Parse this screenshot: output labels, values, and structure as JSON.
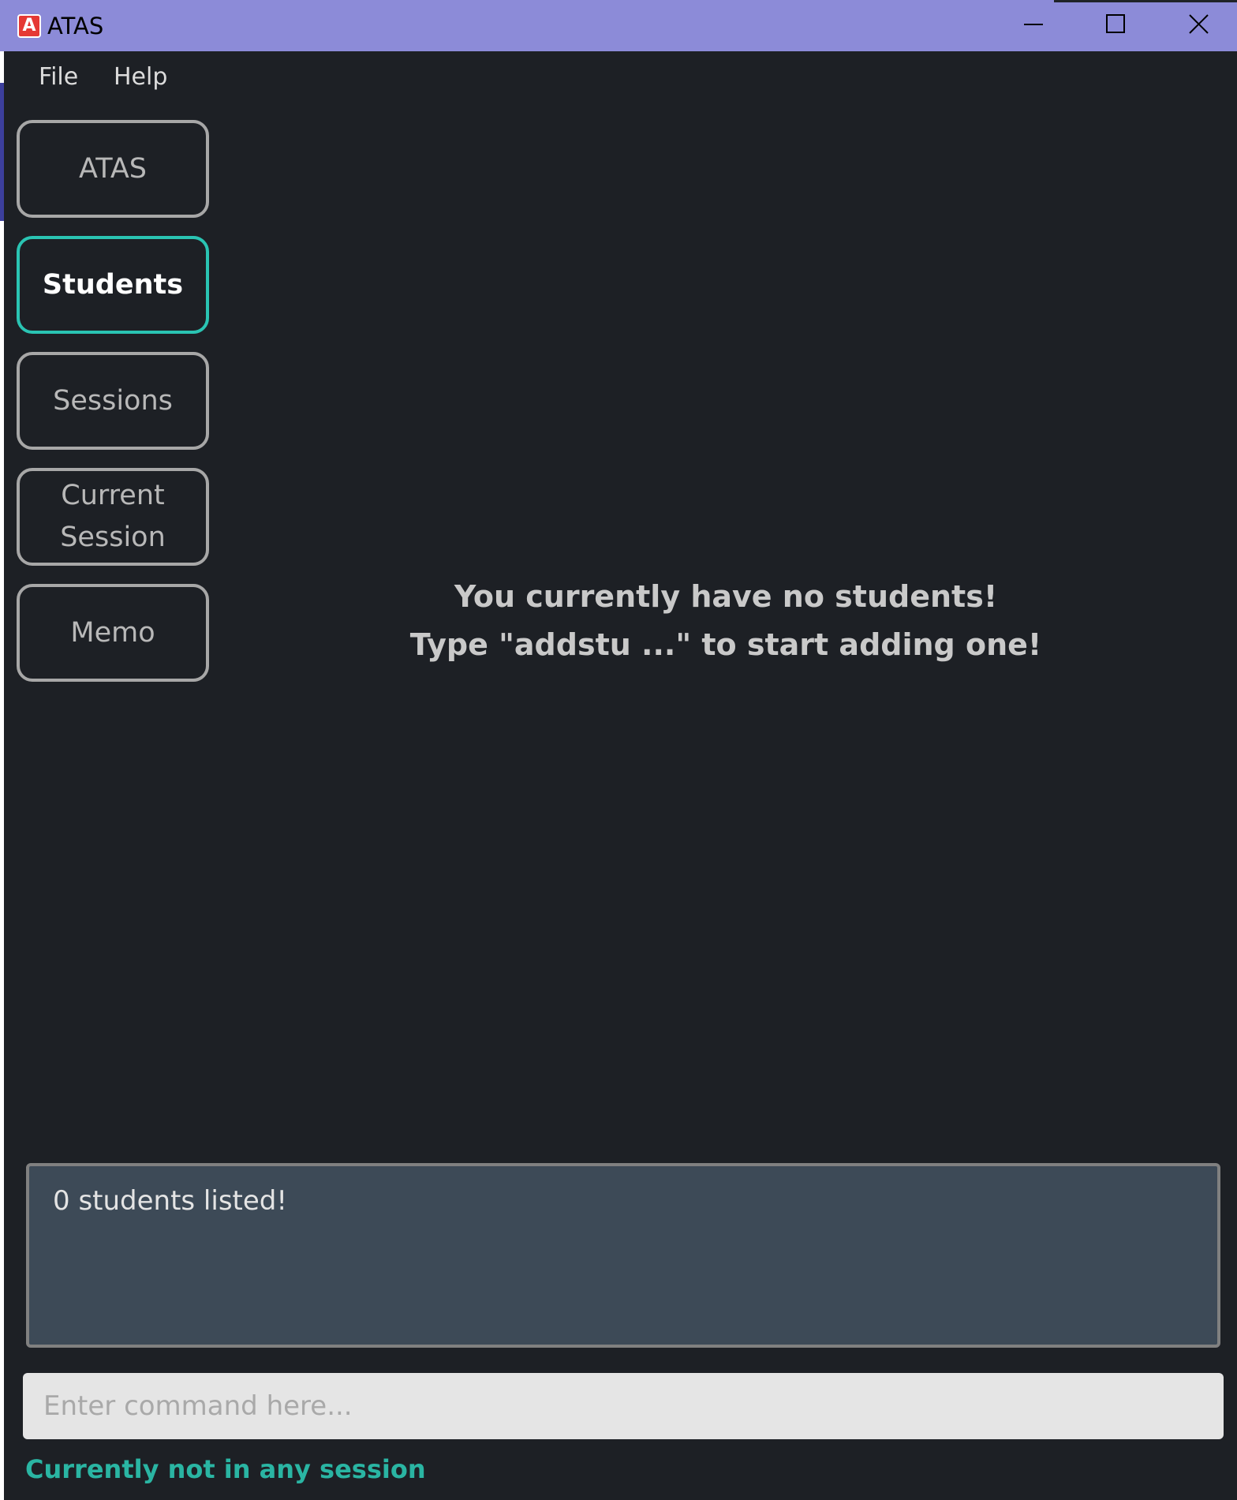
{
  "window": {
    "title": "ATAS",
    "icon_letter": "A",
    "icon_name": "app-logo-icon",
    "controls": [
      "minimize-icon",
      "maximize-icon",
      "close-icon"
    ]
  },
  "menu": {
    "file": "File",
    "help": "Help"
  },
  "nav": {
    "atas": "ATAS",
    "students": "Students",
    "sessions": "Sessions",
    "current_session": "Current Session",
    "memo": "Memo",
    "active": "students"
  },
  "main": {
    "empty_line1": "You currently have no students!",
    "empty_line2": "Type \"addstu ...\" to start adding one!"
  },
  "result": {
    "text": "0 students listed!"
  },
  "command": {
    "value": "",
    "placeholder": "Enter command here..."
  },
  "status": {
    "text": "Currently not in any session"
  },
  "colors": {
    "titlebar": "#8c8bd8",
    "background": "#1d2025",
    "active_accent": "#2ac4b3",
    "status_text": "#2ab5a3",
    "result_box": "#3d4a57"
  }
}
